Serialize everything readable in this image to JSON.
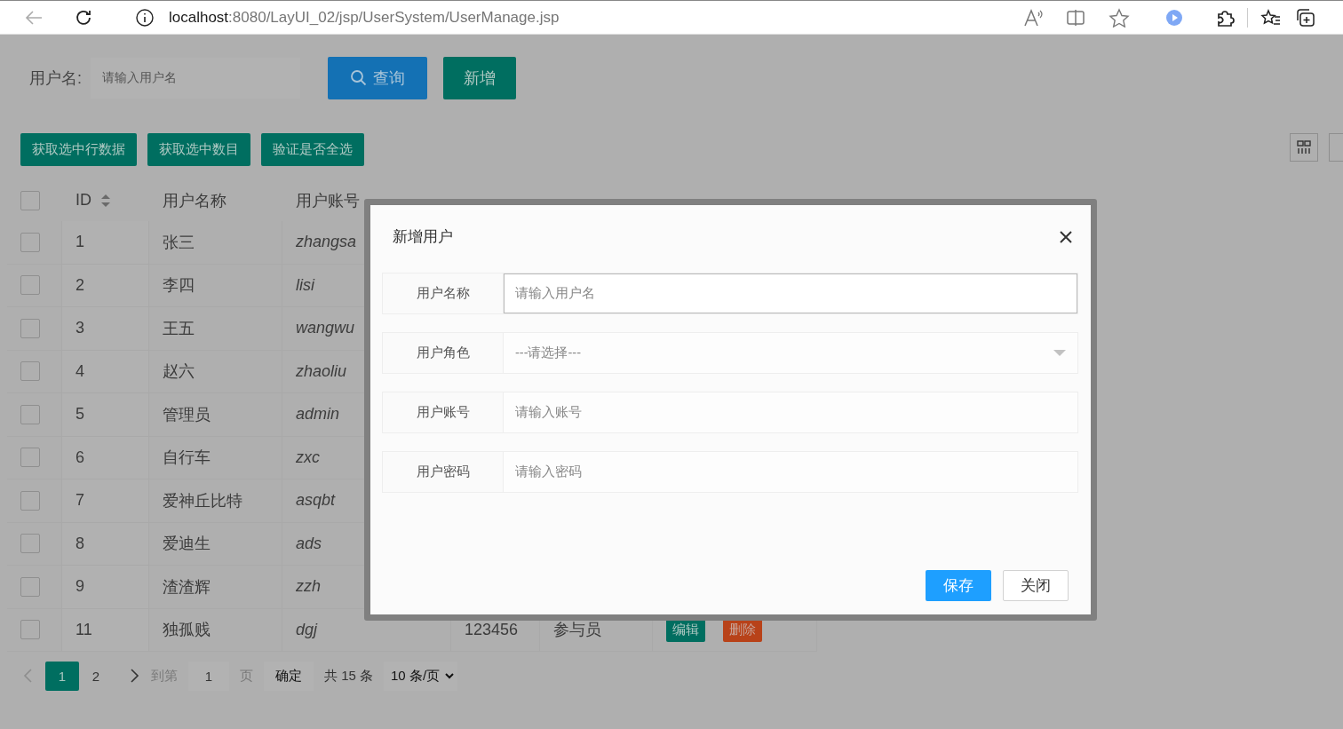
{
  "browser": {
    "url_host": "localhost",
    "url_path": ":8080/LayUI_02/jsp/UserSystem/UserManage.jsp"
  },
  "search": {
    "label": "用户名:",
    "placeholder": "请输入用户名",
    "buttons": [
      {
        "label": "查询",
        "kind": "search"
      },
      {
        "label": "新增",
        "kind": "add"
      }
    ]
  },
  "toolbar": {
    "buttons": [
      "获取选中行数据",
      "获取选中数目",
      "验证是否全选"
    ]
  },
  "table": {
    "header_checked": false,
    "columns": [
      {
        "label": "ID",
        "sortable": true
      },
      {
        "label": "用户名称",
        "sortable": false
      },
      {
        "label": "用户账号",
        "sortable": false
      }
    ],
    "rows": [
      {
        "checked": false,
        "cells": [
          "1",
          "张三",
          "zhangsa"
        ]
      },
      {
        "checked": false,
        "cells": [
          "2",
          "李四",
          "lisi"
        ]
      },
      {
        "checked": false,
        "cells": [
          "3",
          "王五",
          "wangwu"
        ]
      },
      {
        "checked": false,
        "cells": [
          "4",
          "赵六",
          "zhaoliu"
        ]
      },
      {
        "checked": false,
        "cells": [
          "5",
          "管理员",
          "admin"
        ]
      },
      {
        "checked": false,
        "cells": [
          "6",
          "自行车",
          "zxc"
        ]
      },
      {
        "checked": false,
        "cells": [
          "7",
          "爱神丘比特",
          "asqbt"
        ]
      },
      {
        "checked": false,
        "cells": [
          "8",
          "爱迪生",
          "ads"
        ]
      },
      {
        "checked": false,
        "cells": [
          "9",
          "渣渣辉",
          "zzh"
        ]
      },
      {
        "checked": false,
        "cells": [
          "11",
          "独孤贱",
          "dgj",
          "123456",
          "参与员"
        ],
        "actions": [
          {
            "label": "编辑",
            "kind": "edit"
          },
          {
            "label": "删除",
            "kind": "delete"
          }
        ]
      }
    ]
  },
  "pager": {
    "prev_disabled": true,
    "pages": [
      {
        "label": "1",
        "selected": true
      },
      {
        "label": "2",
        "selected": false
      }
    ],
    "goto_label": "到第",
    "goto_value": "1",
    "page_unit": "页",
    "confirm": "确定",
    "total": "共 15 条",
    "page_size": "10 条/页"
  },
  "modal": {
    "title": "新增用户",
    "fields": [
      {
        "label": "用户名称",
        "kind": "text",
        "placeholder": "请输入用户名",
        "focused": true
      },
      {
        "label": "用户角色",
        "kind": "select",
        "placeholder": "---请选择---",
        "focused": false
      },
      {
        "label": "用户账号",
        "kind": "text",
        "placeholder": "请输入账号",
        "focused": false
      },
      {
        "label": "用户密码",
        "kind": "text",
        "placeholder": "请输入密码",
        "focused": false
      }
    ],
    "buttons": [
      {
        "label": "保存",
        "kind": "primary"
      },
      {
        "label": "关闭",
        "kind": "secondary"
      }
    ]
  }
}
